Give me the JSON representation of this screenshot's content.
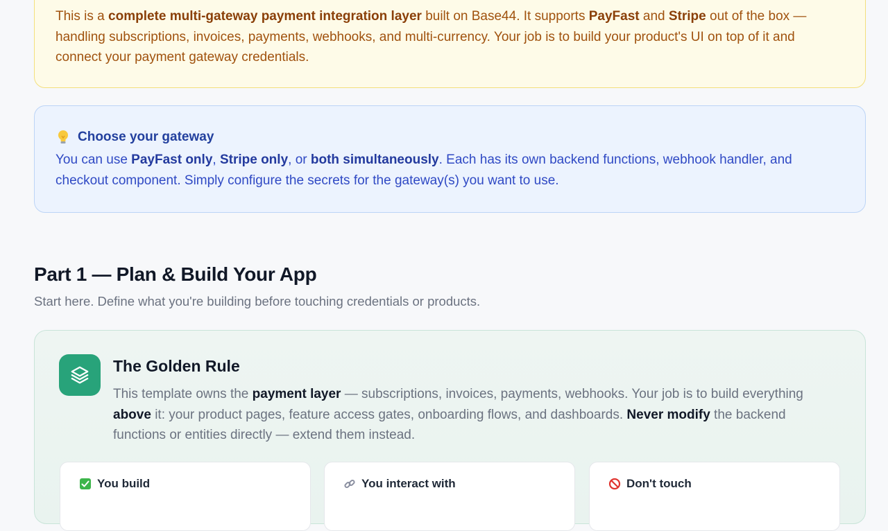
{
  "intro": {
    "segments": [
      {
        "text": "This is a ",
        "bold": false
      },
      {
        "text": "complete multi-gateway payment integration layer",
        "bold": true
      },
      {
        "text": " built on Base44. It supports ",
        "bold": false
      },
      {
        "text": "PayFast",
        "bold": true
      },
      {
        "text": " and ",
        "bold": false
      },
      {
        "text": "Stripe",
        "bold": true
      },
      {
        "text": " out of the box — handling subscriptions, invoices, payments, webhooks, and multi-currency. Your job is to build your product's UI on top of it and connect your payment gateway credentials.",
        "bold": false
      }
    ]
  },
  "gateway": {
    "title": "Choose your gateway",
    "icon": "lightbulb-icon",
    "segments": [
      {
        "text": "You can use ",
        "bold": false
      },
      {
        "text": "PayFast only",
        "bold": true
      },
      {
        "text": ", ",
        "bold": false
      },
      {
        "text": "Stripe only",
        "bold": true
      },
      {
        "text": ", or ",
        "bold": false
      },
      {
        "text": "both simultaneously",
        "bold": true
      },
      {
        "text": ". Each has its own backend functions, webhook handler, and checkout component. Simply configure the secrets for the gateway(s) you want to use.",
        "bold": false
      }
    ]
  },
  "part1": {
    "title": "Part 1 — Plan & Build Your App",
    "subtitle": "Start here. Define what you're building before touching credentials or products."
  },
  "golden_rule": {
    "title": "The Golden Rule",
    "icon": "layers-icon",
    "segments": [
      {
        "text": "This template owns the ",
        "bold": false
      },
      {
        "text": "payment layer",
        "bold": true
      },
      {
        "text": " — subscriptions, invoices, payments, webhooks. Your job is to build everything ",
        "bold": false
      },
      {
        "text": "above",
        "bold": true
      },
      {
        "text": " it: your product pages, feature access gates, onboarding flows, and dashboards. ",
        "bold": false
      },
      {
        "text": "Never modify",
        "bold": true
      },
      {
        "text": " the backend functions or entities directly — extend them instead.",
        "bold": false
      }
    ],
    "cards": [
      {
        "label": "You build",
        "icon": "check-box-icon"
      },
      {
        "label": "You interact with",
        "icon": "link-icon"
      },
      {
        "label": "Don't touch",
        "icon": "prohibited-icon"
      }
    ]
  },
  "colors": {
    "intro_bg": "#fefbe8",
    "intro_text": "#a0520e",
    "gateway_bg": "#ecf3fe",
    "gateway_text": "#2f49c4",
    "accent_green": "#28a37a"
  }
}
